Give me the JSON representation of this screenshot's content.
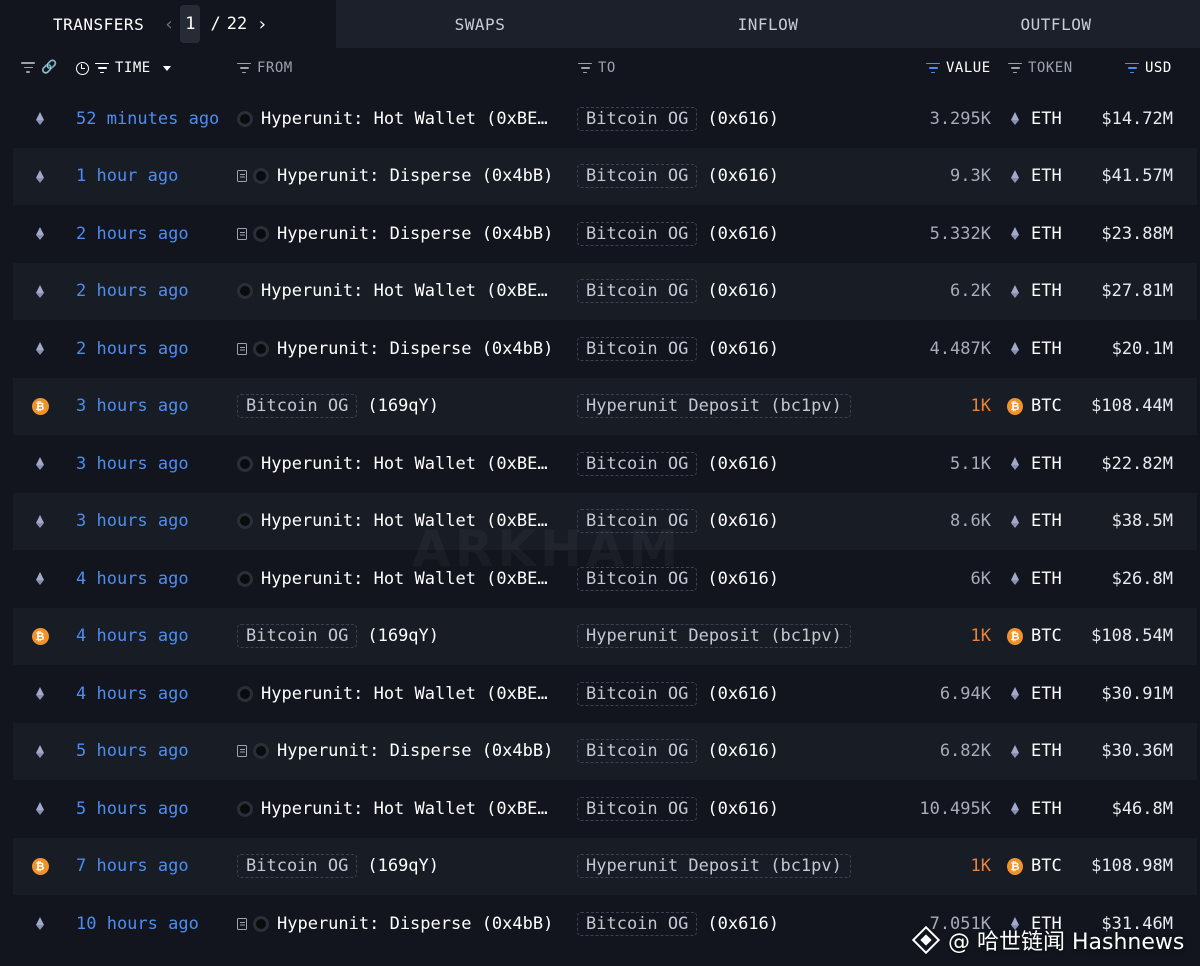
{
  "tabs": {
    "transfers": "TRANSFERS",
    "swaps": "SWAPS",
    "inflow": "INFLOW",
    "outflow": "OUTFLOW"
  },
  "pager": {
    "current": "1",
    "separator": "/",
    "total": "22"
  },
  "header": {
    "time": "TIME",
    "from": "FROM",
    "to": "TO",
    "value": "VALUE",
    "token": "TOKEN",
    "usd": "USD"
  },
  "rows": [
    {
      "chain": "eth",
      "time": "52 minutes ago",
      "from_type": "hu",
      "from_doc": false,
      "from": "Hyperunit: Hot Wallet (0xBE…",
      "to_pill": "Bitcoin OG",
      "to_addr": "(0x616)",
      "value": "3.295K",
      "token": "ETH",
      "usd": "$14.72M"
    },
    {
      "chain": "eth",
      "time": "1 hour ago",
      "from_type": "hu",
      "from_doc": true,
      "from": "Hyperunit: Disperse (0x4bB)",
      "to_pill": "Bitcoin OG",
      "to_addr": "(0x616)",
      "value": "9.3K",
      "token": "ETH",
      "usd": "$41.57M"
    },
    {
      "chain": "eth",
      "time": "2 hours ago",
      "from_type": "hu",
      "from_doc": true,
      "from": "Hyperunit: Disperse (0x4bB)",
      "to_pill": "Bitcoin OG",
      "to_addr": "(0x616)",
      "value": "5.332K",
      "token": "ETH",
      "usd": "$23.88M"
    },
    {
      "chain": "eth",
      "time": "2 hours ago",
      "from_type": "hu",
      "from_doc": false,
      "from": "Hyperunit: Hot Wallet (0xBE…",
      "to_pill": "Bitcoin OG",
      "to_addr": "(0x616)",
      "value": "6.2K",
      "token": "ETH",
      "usd": "$27.81M"
    },
    {
      "chain": "eth",
      "time": "2 hours ago",
      "from_type": "hu",
      "from_doc": true,
      "from": "Hyperunit: Disperse (0x4bB)",
      "to_pill": "Bitcoin OG",
      "to_addr": "(0x616)",
      "value": "4.487K",
      "token": "ETH",
      "usd": "$20.1M"
    },
    {
      "chain": "btc",
      "time": "3 hours ago",
      "from_type": "pill",
      "from_pill": "Bitcoin OG",
      "from": "(169qY)",
      "to_pill": "Hyperunit Deposit (bc1pv)",
      "to_addr": "",
      "value": "1K",
      "token": "BTC",
      "usd": "$108.44M"
    },
    {
      "chain": "eth",
      "time": "3 hours ago",
      "from_type": "hu",
      "from_doc": false,
      "from": "Hyperunit: Hot Wallet (0xBE…",
      "to_pill": "Bitcoin OG",
      "to_addr": "(0x616)",
      "value": "5.1K",
      "token": "ETH",
      "usd": "$22.82M"
    },
    {
      "chain": "eth",
      "time": "3 hours ago",
      "from_type": "hu",
      "from_doc": false,
      "from": "Hyperunit: Hot Wallet (0xBE…",
      "to_pill": "Bitcoin OG",
      "to_addr": "(0x616)",
      "value": "8.6K",
      "token": "ETH",
      "usd": "$38.5M"
    },
    {
      "chain": "eth",
      "time": "4 hours ago",
      "from_type": "hu",
      "from_doc": false,
      "from": "Hyperunit: Hot Wallet (0xBE…",
      "to_pill": "Bitcoin OG",
      "to_addr": "(0x616)",
      "value": "6K",
      "token": "ETH",
      "usd": "$26.8M"
    },
    {
      "chain": "btc",
      "time": "4 hours ago",
      "from_type": "pill",
      "from_pill": "Bitcoin OG",
      "from": "(169qY)",
      "to_pill": "Hyperunit Deposit (bc1pv)",
      "to_addr": "",
      "value": "1K",
      "token": "BTC",
      "usd": "$108.54M"
    },
    {
      "chain": "eth",
      "time": "4 hours ago",
      "from_type": "hu",
      "from_doc": false,
      "from": "Hyperunit: Hot Wallet (0xBE…",
      "to_pill": "Bitcoin OG",
      "to_addr": "(0x616)",
      "value": "6.94K",
      "token": "ETH",
      "usd": "$30.91M"
    },
    {
      "chain": "eth",
      "time": "5 hours ago",
      "from_type": "hu",
      "from_doc": true,
      "from": "Hyperunit: Disperse (0x4bB)",
      "to_pill": "Bitcoin OG",
      "to_addr": "(0x616)",
      "value": "6.82K",
      "token": "ETH",
      "usd": "$30.36M"
    },
    {
      "chain": "eth",
      "time": "5 hours ago",
      "from_type": "hu",
      "from_doc": false,
      "from": "Hyperunit: Hot Wallet (0xBE…",
      "to_pill": "Bitcoin OG",
      "to_addr": "(0x616)",
      "value": "10.495K",
      "token": "ETH",
      "usd": "$46.8M"
    },
    {
      "chain": "btc",
      "time": "7 hours ago",
      "from_type": "pill",
      "from_pill": "Bitcoin OG",
      "from": "(169qY)",
      "to_pill": "Hyperunit Deposit (bc1pv)",
      "to_addr": "",
      "value": "1K",
      "token": "BTC",
      "usd": "$108.98M"
    },
    {
      "chain": "eth",
      "time": "10 hours ago",
      "from_type": "hu",
      "from_doc": true,
      "from": "Hyperunit: Disperse (0x4bB)",
      "to_pill": "Bitcoin OG",
      "to_addr": "(0x616)",
      "value": "7.051K",
      "token": "ETH",
      "usd": "$31.46M"
    }
  ],
  "watermark": "ARKHAM",
  "credit": "@ 哈世链闻 Hashnews",
  "colors": {
    "accent": "#4d8df0",
    "btc": "#f0932b",
    "btc_value": "#e9843a",
    "background": "#12151d"
  }
}
